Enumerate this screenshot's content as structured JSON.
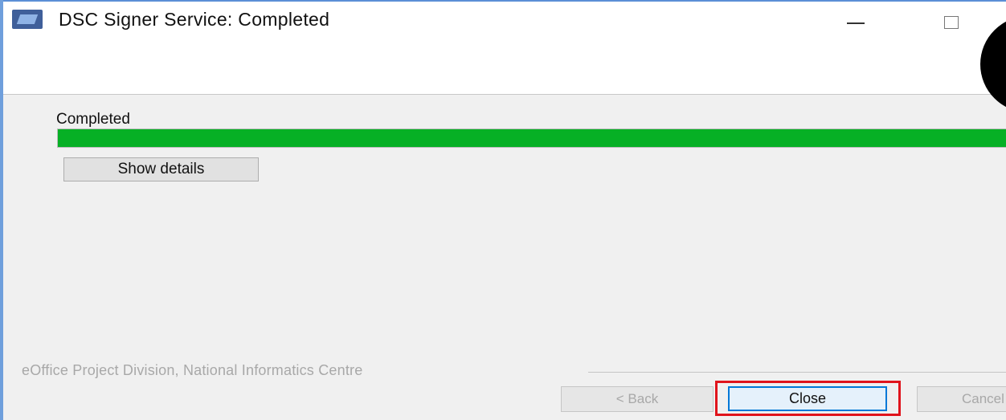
{
  "window": {
    "title": "DSC Signer Service: Completed",
    "app_icon": "app-icon",
    "minimize_icon": "minimize-icon",
    "maximize_icon": "maximize-icon"
  },
  "main": {
    "status_label": "Completed",
    "progress": 1.0,
    "progress_color": "#06b025",
    "show_details_label": "Show details"
  },
  "footer": {
    "brand_text": "eOffice Project Division, National Informatics Centre",
    "back_label": "< Back",
    "close_label": "Close",
    "cancel_label": "Cancel",
    "highlight_color": "#e0141c"
  }
}
